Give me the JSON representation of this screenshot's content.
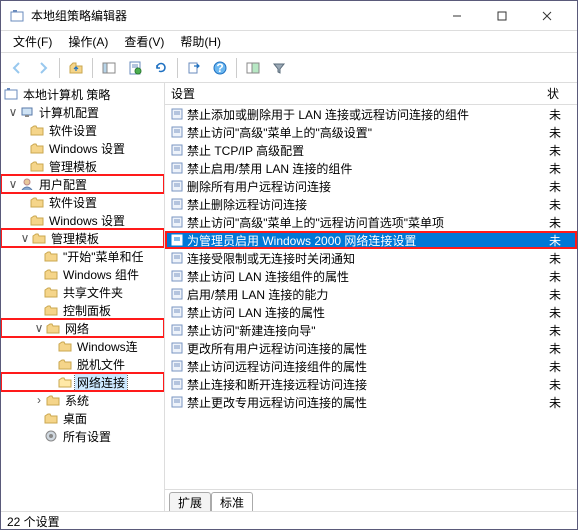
{
  "window": {
    "title": "本地组策略编辑器"
  },
  "menu": {
    "file": "文件(F)",
    "action": "操作(A)",
    "view": "查看(V)",
    "help": "帮助(H)"
  },
  "tree": {
    "root": "本地计算机 策略",
    "computer_config": "计算机配置",
    "software_settings_1": "软件设置",
    "windows_settings_1": "Windows 设置",
    "admin_templates_1": "管理模板",
    "user_config": "用户配置",
    "software_settings_2": "软件设置",
    "windows_settings_2": "Windows 设置",
    "admin_templates_2": "管理模板",
    "start_menu": "\"开始\"菜单和任",
    "windows_comp": "Windows 组件",
    "shared_folders": "共享文件夹",
    "control_panel": "控制面板",
    "network": "网络",
    "windows_conn": "Windows连",
    "offline_files": "脱机文件",
    "network_conn": "网络连接",
    "system": "系统",
    "desktop": "桌面",
    "all_settings": "所有设置"
  },
  "list": {
    "col_setting": "设置",
    "col_state": "状",
    "items": [
      {
        "text": "禁止添加或删除用于 LAN 连接或远程访问连接的组件",
        "state": "未"
      },
      {
        "text": "禁止访问\"高级\"菜单上的\"高级设置\"",
        "state": "未"
      },
      {
        "text": "禁止 TCP/IP 高级配置",
        "state": "未"
      },
      {
        "text": "禁止启用/禁用 LAN 连接的组件",
        "state": "未"
      },
      {
        "text": "删除所有用户远程访问连接",
        "state": "未"
      },
      {
        "text": "禁止删除远程访问连接",
        "state": "未"
      },
      {
        "text": "禁止访问\"高级\"菜单上的\"远程访问首选项\"菜单项",
        "state": "未"
      },
      {
        "text": "为管理员启用 Windows 2000 网络连接设置",
        "state": "未"
      },
      {
        "text": "连接受限制或无连接时关闭通知",
        "state": "未"
      },
      {
        "text": "禁止访问 LAN 连接组件的属性",
        "state": "未"
      },
      {
        "text": "启用/禁用 LAN 连接的能力",
        "state": "未"
      },
      {
        "text": "禁止访问 LAN 连接的属性",
        "state": "未"
      },
      {
        "text": "禁止访问\"新建连接向导\"",
        "state": "未"
      },
      {
        "text": "更改所有用户远程访问连接的属性",
        "state": "未"
      },
      {
        "text": "禁止访问远程访问连接组件的属性",
        "state": "未"
      },
      {
        "text": "禁止连接和断开连接远程访问连接",
        "state": "未"
      },
      {
        "text": "禁止更改专用远程访问连接的属性",
        "state": "未"
      }
    ]
  },
  "tabs": {
    "extended": "扩展",
    "standard": "标准"
  },
  "status": {
    "count": "22 个设置"
  }
}
